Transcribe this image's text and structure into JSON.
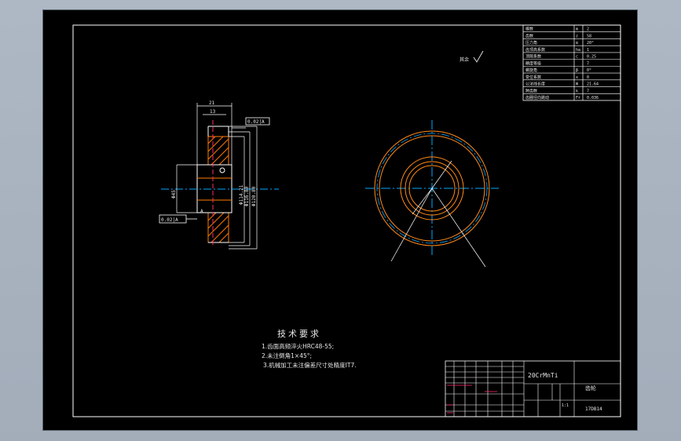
{
  "tech_requirements": {
    "title": "技术要求",
    "items": [
      "1.齿面高频淬火HRC48-55;",
      "2.未注倒角1×45°;",
      "3.机械加工未注偏差尺寸处精度IT7."
    ]
  },
  "roughness_note": "其余",
  "datum_a": "A",
  "tolerance_frames": {
    "runout": "0.02|A",
    "parallel": "0.02|A"
  },
  "dimensions": {
    "width": "21",
    "hub": "13",
    "bore": "Φ45",
    "root": "Φ114.21",
    "pitch": "Φ116.80",
    "outer": "Φ120.80"
  },
  "title_block": {
    "material": "20CrMnTi",
    "drawing_no": "17DB14",
    "scale": "1:1",
    "part_name": "齿轮"
  },
  "gear_params": {
    "rows": [
      {
        "name": "模数",
        "sym": "m",
        "val": "2"
      },
      {
        "name": "齿数",
        "sym": "z",
        "val": "58"
      },
      {
        "name": "压力角",
        "sym": "α",
        "val": "20°"
      },
      {
        "name": "齿顶高系数",
        "sym": "ha",
        "val": "1"
      },
      {
        "name": "顶隙系数",
        "sym": "c",
        "val": "0.25"
      },
      {
        "name": "精度等级",
        "sym": "",
        "val": "7"
      },
      {
        "name": "螺旋角",
        "sym": "β",
        "val": "0°"
      },
      {
        "name": "变位系数",
        "sym": "x",
        "val": "0"
      },
      {
        "name": "公法线长度",
        "sym": "W",
        "val": "21.64"
      },
      {
        "name": "跨齿数",
        "sym": "k",
        "val": "7"
      },
      {
        "name": "齿圈径向跳动",
        "sym": "Fr",
        "val": "0.036"
      }
    ]
  },
  "colors": {
    "frame": "#ffffff",
    "line": "#ffffff",
    "center": "#00a8ff",
    "circle_orange": "#ff8a1a",
    "hatch": "#ff7b00",
    "leader": "#ff2a6a"
  }
}
